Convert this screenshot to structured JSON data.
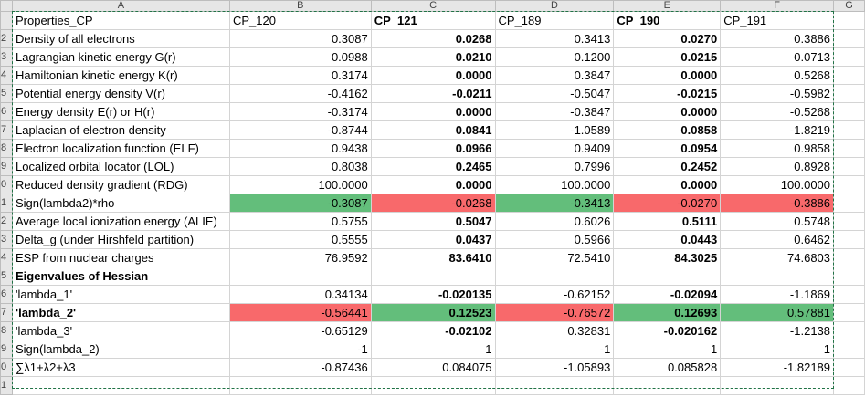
{
  "columns": [
    "A",
    "B",
    "C",
    "D",
    "E",
    "F",
    "G"
  ],
  "row_numbers": [
    "",
    "2",
    "3",
    "4",
    "5",
    "6",
    "7",
    "8",
    "9",
    "0",
    "1",
    "2",
    "3",
    "4",
    "5",
    "6",
    "7",
    "8",
    "9",
    "0",
    "1",
    ""
  ],
  "header_row": {
    "a": "Properties_CP",
    "b": "CP_120",
    "c": "CP_121",
    "d": "CP_189",
    "e": "CP_190",
    "f": "CP_191"
  },
  "rows": [
    {
      "a": "Density of all electrons",
      "b": "0.3087",
      "c": "0.0268",
      "d": "0.3413",
      "e": "0.0270",
      "f": "0.3886"
    },
    {
      "a": "Lagrangian kinetic energy G(r)",
      "b": "0.0988",
      "c": "0.0210",
      "d": "0.1200",
      "e": "0.0215",
      "f": "0.0713"
    },
    {
      "a": "Hamiltonian kinetic energy K(r)",
      "b": "0.3174",
      "c": "0.0000",
      "d": "0.3847",
      "e": "0.0000",
      "f": "0.5268"
    },
    {
      "a": "Potential energy density V(r)",
      "b": "-0.4162",
      "c": "-0.0211",
      "d": "-0.5047",
      "e": "-0.0215",
      "f": "-0.5982"
    },
    {
      "a": "Energy density E(r) or H(r)",
      "b": "-0.3174",
      "c": "0.0000",
      "d": "-0.3847",
      "e": "0.0000",
      "f": "-0.5268"
    },
    {
      "a": "Laplacian of electron density",
      "b": "-0.8744",
      "c": "0.0841",
      "d": "-1.0589",
      "e": "0.0858",
      "f": "-1.8219"
    },
    {
      "a": "Electron localization function (ELF)",
      "b": "0.9438",
      "c": "0.0966",
      "d": "0.9409",
      "e": "0.0954",
      "f": "0.9858"
    },
    {
      "a": "Localized orbital locator (LOL)",
      "b": "0.8038",
      "c": "0.2465",
      "d": "0.7996",
      "e": "0.2452",
      "f": "0.8928"
    },
    {
      "a": "Reduced density gradient (RDG)",
      "b": "100.0000",
      "c": "0.0000",
      "d": "100.0000",
      "e": "0.0000",
      "f": "100.0000"
    },
    {
      "a": "Sign(lambda2)*rho",
      "b": "-0.3087",
      "c": "-0.0268",
      "d": "-0.3413",
      "e": "-0.0270",
      "f": "-0.3886"
    },
    {
      "a": "Average local ionization energy (ALIE)",
      "b": "0.5755",
      "c": "0.5047",
      "d": "0.6026",
      "e": "0.5111",
      "f": "0.5748"
    },
    {
      "a": "Delta_g (under Hirshfeld partition)",
      "b": "0.5555",
      "c": "0.0437",
      "d": "0.5966",
      "e": "0.0443",
      "f": "0.6462"
    },
    {
      "a": "ESP from nuclear charges",
      "b": "76.9592",
      "c": "83.6410",
      "d": "72.5410",
      "e": "84.3025",
      "f": "74.6803"
    },
    {
      "a": "Eigenvalues of Hessian",
      "b": "",
      "c": "",
      "d": "",
      "e": "",
      "f": ""
    },
    {
      "a": "'lambda_1'",
      "b": "0.34134",
      "c": "-0.020135",
      "d": "-0.62152",
      "e": "-0.02094",
      "f": "-1.1869"
    },
    {
      "a": "'lambda_2'",
      "b": "-0.56441",
      "c": "0.12523",
      "d": "-0.76572",
      "e": "0.12693",
      "f": "0.57881"
    },
    {
      "a": "'lambda_3'",
      "b": "-0.65129",
      "c": "-0.02102",
      "d": "0.32831",
      "e": "-0.020162",
      "f": "-1.2138"
    },
    {
      "a": "Sign(lambda_2)",
      "b": "-1",
      "c": "1",
      "d": "-1",
      "e": "1",
      "f": "1"
    },
    {
      "a": "∑λ1+λ2+λ3",
      "b": "-0.87436",
      "c": "0.084075",
      "d": "-1.05893",
      "e": "0.085828",
      "f": "-1.82189"
    }
  ],
  "colors": {
    "green": "#63be7b",
    "red": "#f8696b",
    "selection": "#217346"
  }
}
